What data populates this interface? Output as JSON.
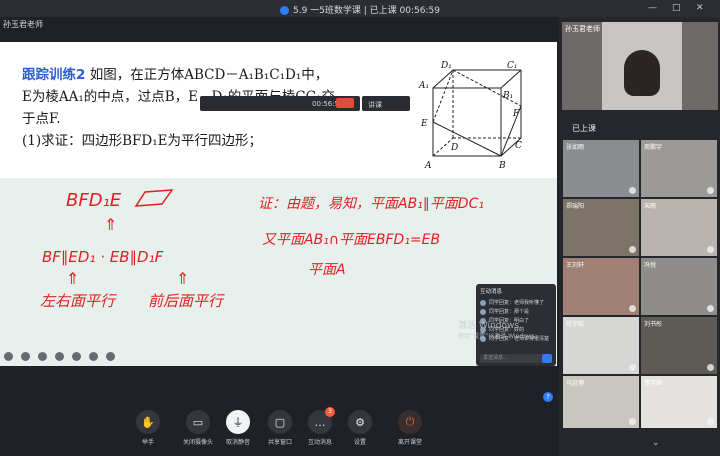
{
  "window": {
    "title": "5.9 一5班数学课 | 已上课 00:56:59",
    "minimize": "—",
    "maximize": "□",
    "close": "✕"
  },
  "teacher_label": "孙玉君老师",
  "problem": {
    "tag": "跟踪训练2",
    "line1": " 如图，在正方体ABCD－A₁B₁C₁D₁中，",
    "line2": "E为棱AA₁的中点，过点B，E，D₁的平面与棱CC₁交",
    "line3": "于点F.",
    "line4": "(1)求证：四边形BFD₁E为平行四边形；"
  },
  "cube_labels": {
    "D1": "D₁",
    "C1": "C₁",
    "A1": "A₁",
    "B1": "B₁",
    "E": "E",
    "D": "D",
    "F": "F",
    "C": "C",
    "A": "A",
    "B": "B"
  },
  "handwriting": {
    "h1": "BFD₁E",
    "h2": "BF∥ED₁ · EB∥D₁F",
    "h3": "左右面平行",
    "h4": "前后面平行",
    "h5": "证：由题，易知，平面AB₁∥平面DC₁",
    "h6": "又平面AB₁∩平面EBFD₁=EB",
    "h7": "平面A"
  },
  "mini_windows": {
    "a": "00:56:5",
    "b": "讲课"
  },
  "chat": {
    "header": "互动消息",
    "messages": [
      "同学回复：老师我听懂了",
      "同学回复：那个是",
      "同学回复：明白了",
      "同学回复：好的",
      "同学回复：老师讲得很清楚"
    ],
    "input_placeholder": "发送消息…"
  },
  "watermark": {
    "line1": "激活 Windows",
    "line2": "转到“设置”以激活 Windows。"
  },
  "toolbar": {
    "items": [
      {
        "label": "举手",
        "icon": "✋"
      },
      {
        "label": "关闭摄像头",
        "icon": "▭"
      },
      {
        "label": "取消静音",
        "icon": "⏚"
      },
      {
        "label": "共享窗口",
        "icon": "▢"
      },
      {
        "label": "互动消息",
        "icon": "…",
        "badge": "3"
      },
      {
        "label": "设置",
        "icon": "⚙"
      },
      {
        "label": "离开课堂",
        "icon": "⏻"
      }
    ]
  },
  "sidebar": {
    "teacher_video_label": "孙玉君老师",
    "status": "已上课",
    "students": [
      {
        "name": "张如雨"
      },
      {
        "name": "周鹏宇"
      },
      {
        "name": "郑瑞阳"
      },
      {
        "name": "宋雨"
      },
      {
        "name": "王刘轩"
      },
      {
        "name": "冯悦"
      },
      {
        "name": "段宇航"
      },
      {
        "name": "刘书彤"
      },
      {
        "name": "马远博"
      },
      {
        "name": "董宇琛"
      },
      {
        "name": "崔羽瑶"
      },
      {
        "name": "刘梓涵"
      }
    ]
  }
}
